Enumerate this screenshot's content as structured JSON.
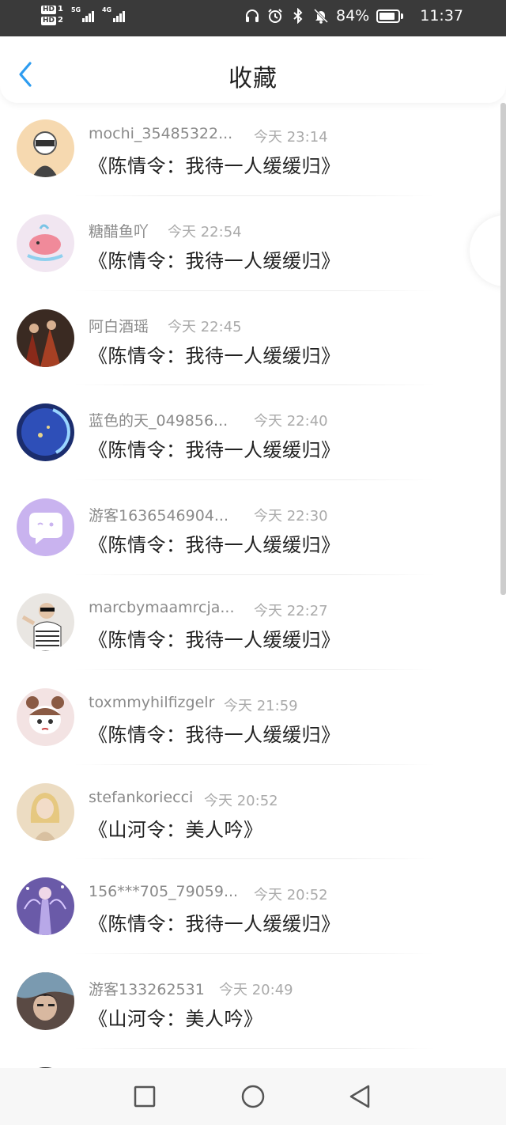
{
  "status_bar": {
    "hd1": "HD",
    "hd1_num": "1",
    "hd2": "HD",
    "hd2_num": "2",
    "net1": "5G",
    "net2": "4G",
    "battery": "84%",
    "time": "11:37",
    "icons": [
      "headphones-icon",
      "alarm-icon",
      "bluetooth-icon",
      "mute-icon",
      "battery-icon"
    ]
  },
  "header": {
    "title": "收藏",
    "back_icon": "chevron-left-icon"
  },
  "items": [
    {
      "user": "mochi_35485322...",
      "time": "今天 23:14",
      "title": "《陈情令：我待一人缓缓归》",
      "avatar_color": "#f6d9b0"
    },
    {
      "user": "糖醋鱼吖",
      "time": "今天 22:54",
      "title": "《陈情令：我待一人缓缓归》",
      "avatar_color": "#f1e6f1"
    },
    {
      "user": "阿白酒瑶",
      "time": "今天 22:45",
      "title": "《陈情令：我待一人缓缓归》",
      "avatar_color": "#3a2a22"
    },
    {
      "user": "蓝色的天_049856...",
      "time": "今天 22:40",
      "title": "《陈情令：我待一人缓缓归》",
      "avatar_color": "#1b2d6e"
    },
    {
      "user": "游客1636546904...",
      "time": "今天 22:30",
      "title": "《陈情令：我待一人缓缓归》",
      "avatar_color": "#c9b3ef"
    },
    {
      "user": "marcbymaamrcja...",
      "time": "今天 22:27",
      "title": "《陈情令：我待一人缓缓归》",
      "avatar_color": "#e9e6e2"
    },
    {
      "user": "toxmmyhilfizgelr",
      "time": "今天 21:59",
      "title": "《陈情令：我待一人缓缓归》",
      "avatar_color": "#f3e3e3"
    },
    {
      "user": "stefankoriecci",
      "time": "今天 20:52",
      "title": "《山河令：美人吟》",
      "avatar_color": "#ecdcc2"
    },
    {
      "user": "156***705_79059...",
      "time": "今天 20:52",
      "title": "《陈情令：我待一人缓缓归》",
      "avatar_color": "#6a5aa8"
    },
    {
      "user": "游客133262531",
      "time": "今天 20:49",
      "title": "《山河令：美人吟》",
      "avatar_color": "#5a4a44"
    }
  ],
  "nav_bar": {
    "icons": [
      "recent-apps-icon",
      "home-icon",
      "back-icon"
    ]
  },
  "colors": {
    "accent": "#2d9cf0",
    "status_bg": "#3a3a3a",
    "text_primary": "#222222",
    "text_secondary": "#8a8a8a"
  }
}
